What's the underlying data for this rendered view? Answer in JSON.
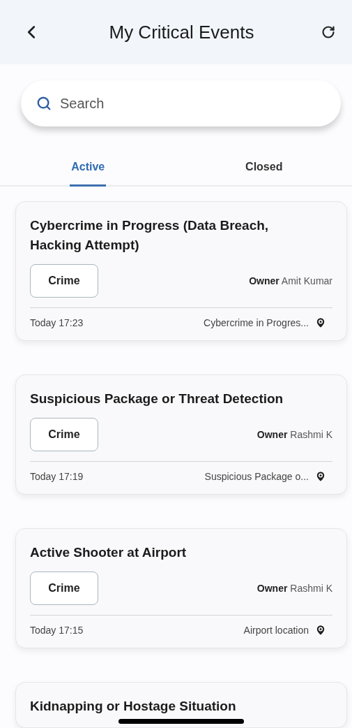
{
  "header": {
    "title": "My Critical Events"
  },
  "search": {
    "placeholder": "Search"
  },
  "tabs": [
    {
      "label": "Active",
      "selected": true
    },
    {
      "label": "Closed",
      "selected": false
    }
  ],
  "events": [
    {
      "title": "Cybercrime in Progress (Data Breach, Hacking Attempt)",
      "category": "Crime",
      "owner": "**Owner** Amit Kumar",
      "time": "Today 17:23",
      "location": "Cybercrime in Progres..."
    },
    {
      "title": "Suspicious Package or Threat Detection",
      "category": "Crime",
      "owner": "**Owner** Rashmi K",
      "time": "Today 17:19",
      "location": "Suspicious Package o..."
    },
    {
      "title": "Active Shooter at Airport",
      "category": "Crime",
      "owner": "**Owner** Rashmi K",
      "time": "Today 17:15",
      "location": "Airport location"
    },
    {
      "title": "Kidnapping or Hostage Situation"
    }
  ]
}
